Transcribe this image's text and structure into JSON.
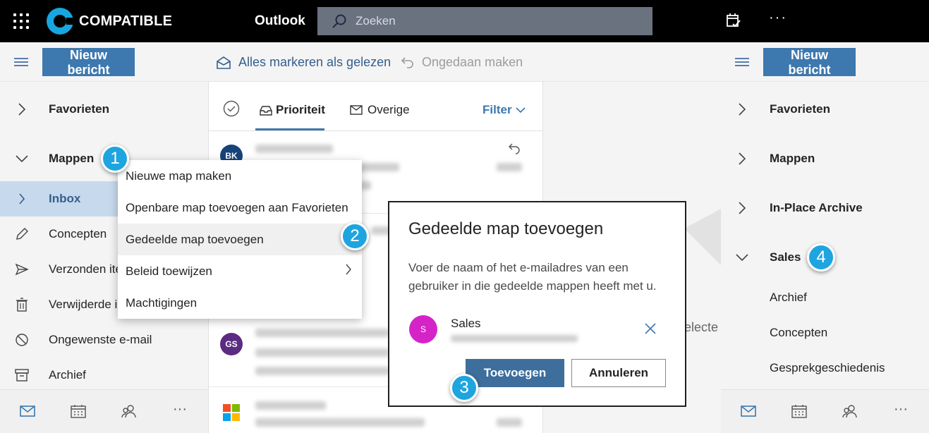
{
  "topbar": {
    "logo_text": "COMPATIBLE",
    "app_name": "Outlook",
    "search_placeholder": "Zoeken"
  },
  "commands": {
    "new_message": "Nieuw bericht",
    "mark_all_read": "Alles markeren als gelezen",
    "undo": "Ongedaan maken"
  },
  "left_nav": {
    "favorites": "Favorieten",
    "folders": "Mappen",
    "items": [
      {
        "label": "Inbox",
        "icon": "chevron-right-icon"
      },
      {
        "label": "Concepten",
        "icon": "pencil-icon"
      },
      {
        "label": "Verzonden ite",
        "icon": "send-icon"
      },
      {
        "label": "Verwijderde i",
        "icon": "trash-icon"
      },
      {
        "label": "Ongewenste e-mail",
        "icon": "block-icon"
      },
      {
        "label": "Archief",
        "icon": "archive-icon"
      }
    ]
  },
  "message_list": {
    "tab_priority": "Prioriteit",
    "tab_other": "Overige",
    "filter": "Filter",
    "avatars": [
      "BK",
      "GS"
    ]
  },
  "context_menu": {
    "items": [
      "Nieuwe map maken",
      "Openbare map toevoegen aan Favorieten",
      "Gedeelde map toevoegen",
      "Beleid toewijzen",
      "Machtigingen"
    ]
  },
  "dialog": {
    "title": "Gedeelde map toevoegen",
    "description": "Voer de naam of het e-mailadres van een gebruiker in die gedeelde mappen heeft met u.",
    "recipient_initial": "S",
    "recipient_name": "Sales",
    "add_button": "Toevoegen",
    "cancel_button": "Annuleren"
  },
  "reading_pane": {
    "partial_text": "electe"
  },
  "right_pane": {
    "new_message": "Nieuw bericht",
    "favorites": "Favorieten",
    "folders": "Mappen",
    "archive": "In-Place Archive",
    "sales": "Sales",
    "sub_items": [
      "Archief",
      "Concepten",
      "Gesprekgeschiedenis"
    ]
  },
  "badges": [
    "1",
    "2",
    "3",
    "4"
  ],
  "colors": {
    "accent": "#3d78ae",
    "badge": "#1ea5df",
    "selected": "#c7d9ec",
    "recipient_avatar": "#d424c8"
  }
}
